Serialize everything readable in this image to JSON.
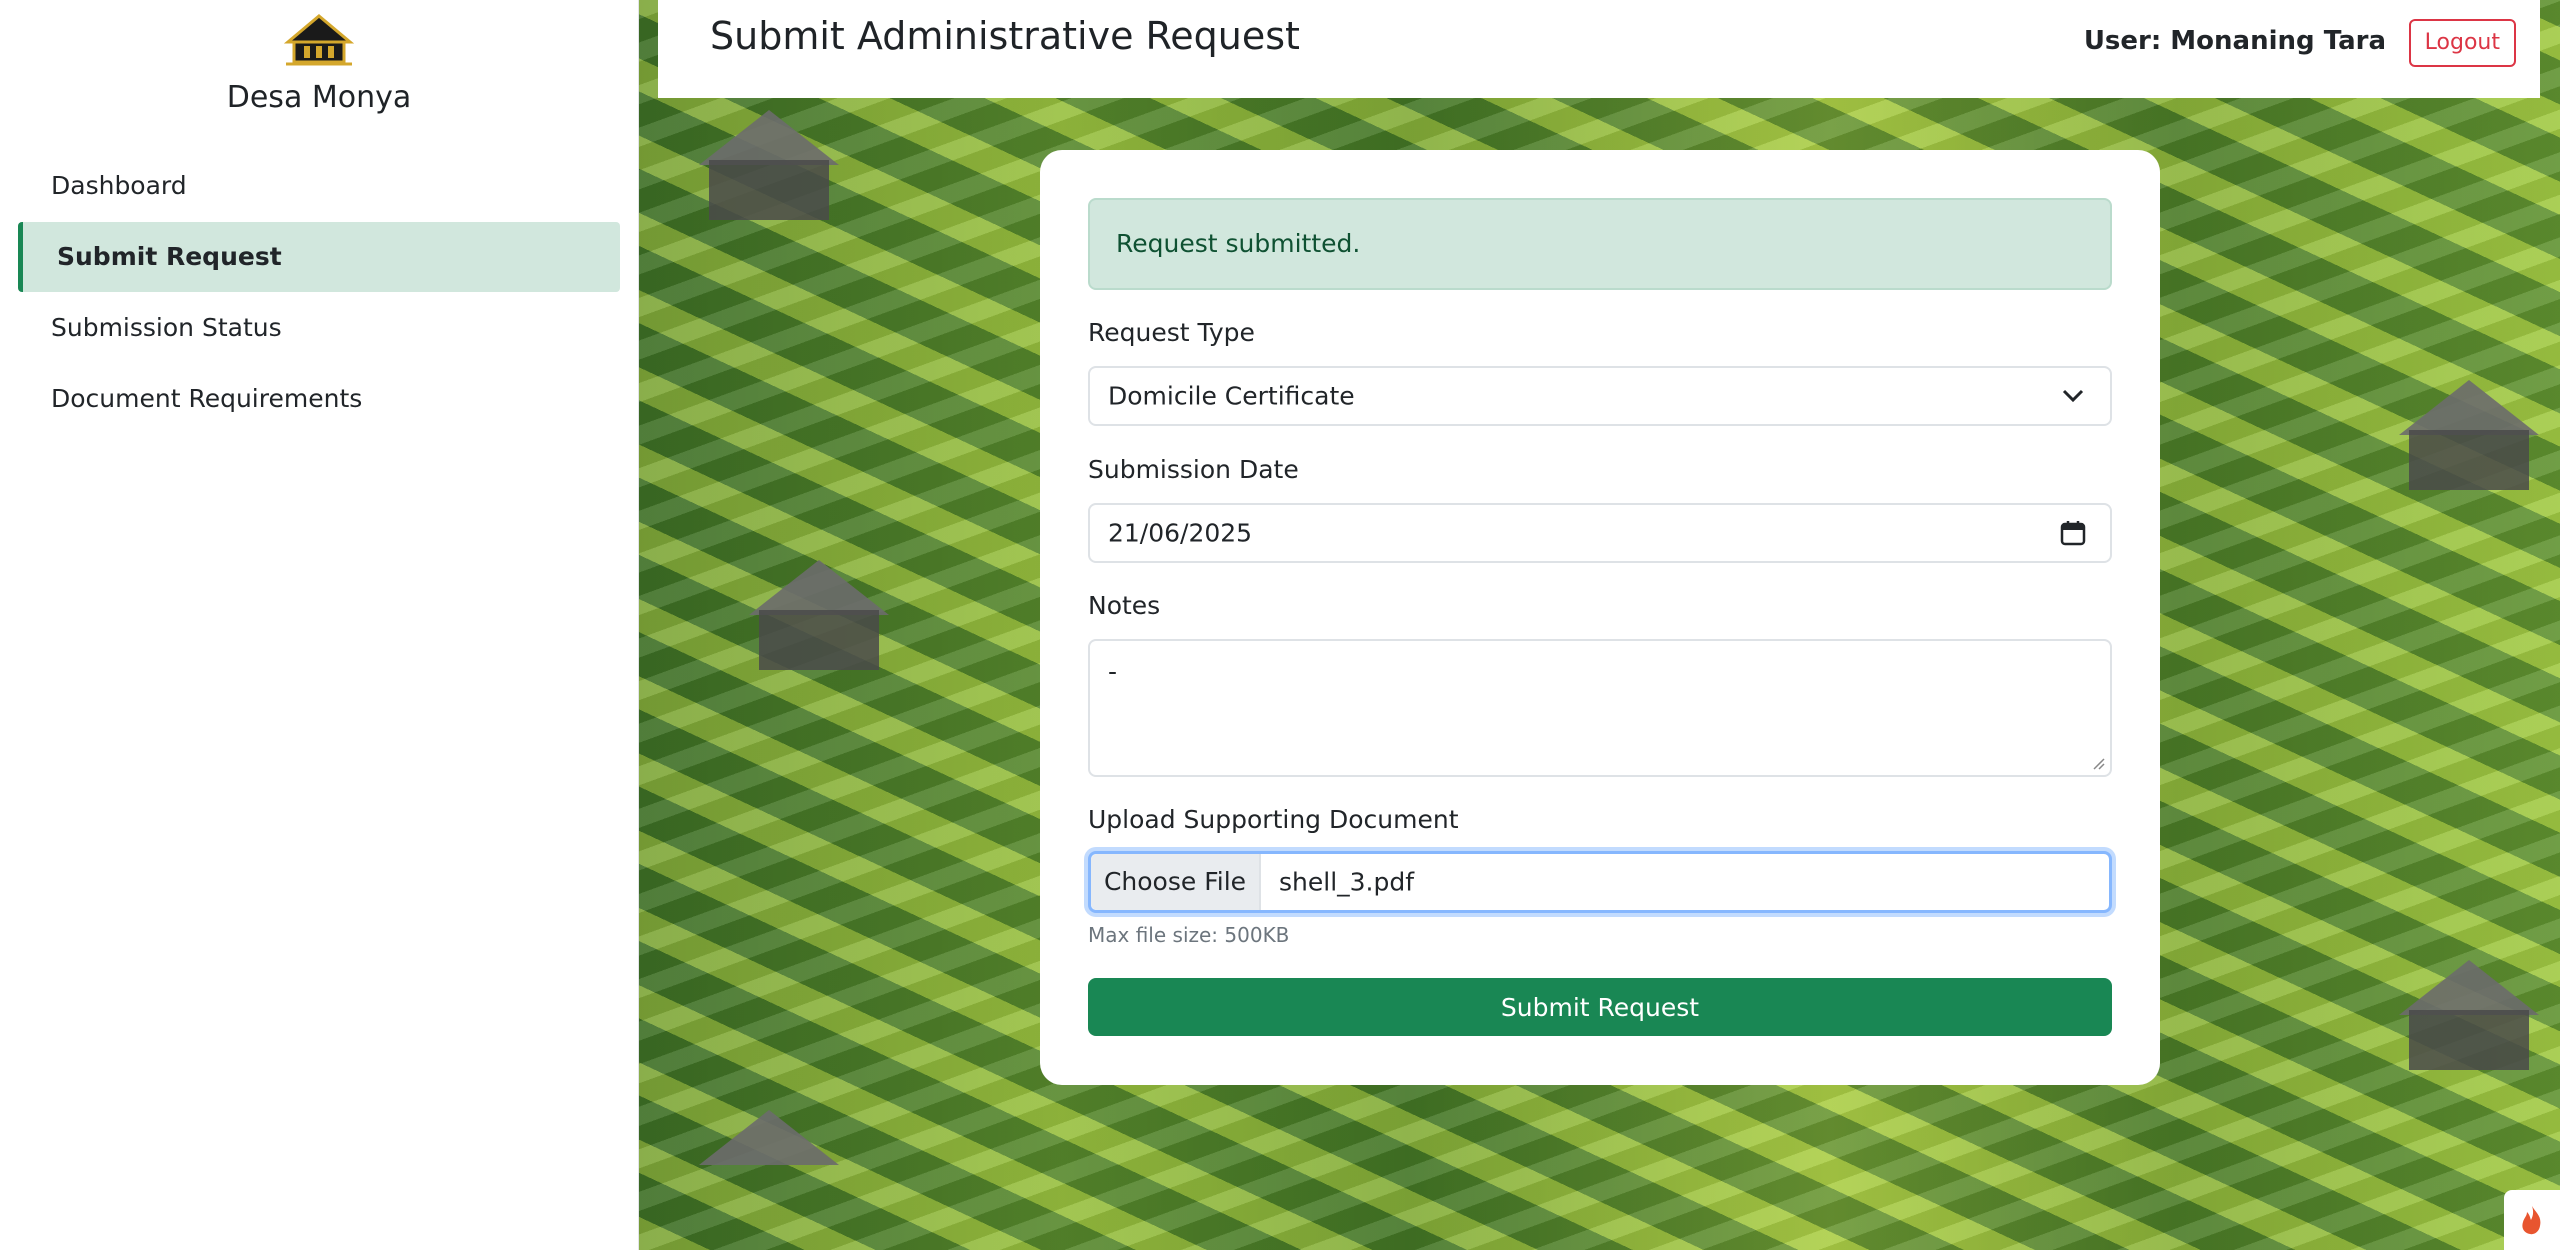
{
  "sidebar": {
    "brand_name": "Desa Monya",
    "items": [
      {
        "label": "Dashboard",
        "active": false
      },
      {
        "label": "Submit Request",
        "active": true
      },
      {
        "label": "Submission Status",
        "active": false
      },
      {
        "label": "Document Requirements",
        "active": false
      }
    ]
  },
  "header": {
    "title": "Submit Administrative Request",
    "user_label": "User: Monaning Tara",
    "logout_label": "Logout"
  },
  "form": {
    "alert_text": "Request submitted.",
    "request_type_label": "Request Type",
    "request_type_value": "Domicile Certificate",
    "submission_date_label": "Submission Date",
    "submission_date_value": "21/06/2025",
    "notes_label": "Notes",
    "notes_value": "-",
    "upload_label": "Upload Supporting Document",
    "choose_file_label": "Choose File",
    "file_name": "shell_3.pdf",
    "upload_hint": "Max file size: 500KB",
    "submit_label": "Submit Request"
  },
  "icons": {
    "brand": "village-house-logo-icon",
    "select": "chevron-down-icon",
    "date": "calendar-icon",
    "resize": "resize-grip-icon",
    "corner": "flame-icon"
  },
  "colors": {
    "accent": "#198754",
    "active_bg": "#d1e7dd",
    "alert_text": "#0f5132",
    "danger": "#dc3545",
    "focus": "#86b7fe"
  }
}
